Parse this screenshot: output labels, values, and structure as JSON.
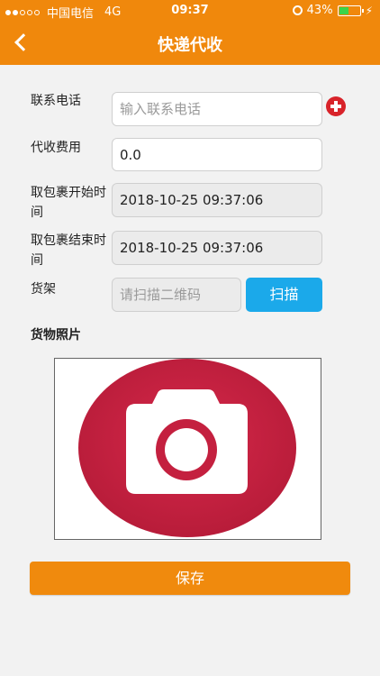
{
  "status_bar": {
    "carrier": "中国电信",
    "network": "4G",
    "time": "09:37",
    "battery": "43%"
  },
  "header": {
    "title": "快递代收",
    "color": "#f0880c"
  },
  "form": {
    "phone": {
      "label": "联系电话",
      "placeholder": "输入联系电话"
    },
    "fee": {
      "label": "代收费用",
      "value": "0.0"
    },
    "start_time": {
      "label_line1": "取包裹开始时",
      "label_line2": "间",
      "value": "2018-10-25 09:37:06"
    },
    "end_time": {
      "label_line1": "取包裹结束时",
      "label_line2": "间",
      "value": "2018-10-25 09:37:06"
    },
    "shelf": {
      "label": "货架",
      "placeholder": "请扫描二维码",
      "scan_label": "扫描"
    },
    "photo": {
      "label": "货物照片",
      "icon": "camera-icon"
    }
  },
  "save_label": "保存",
  "colors": {
    "accent": "#f0880c",
    "scan_button": "#1ba9ea",
    "camera_circle": "#c4203f",
    "add_icon": "#d8232a"
  }
}
